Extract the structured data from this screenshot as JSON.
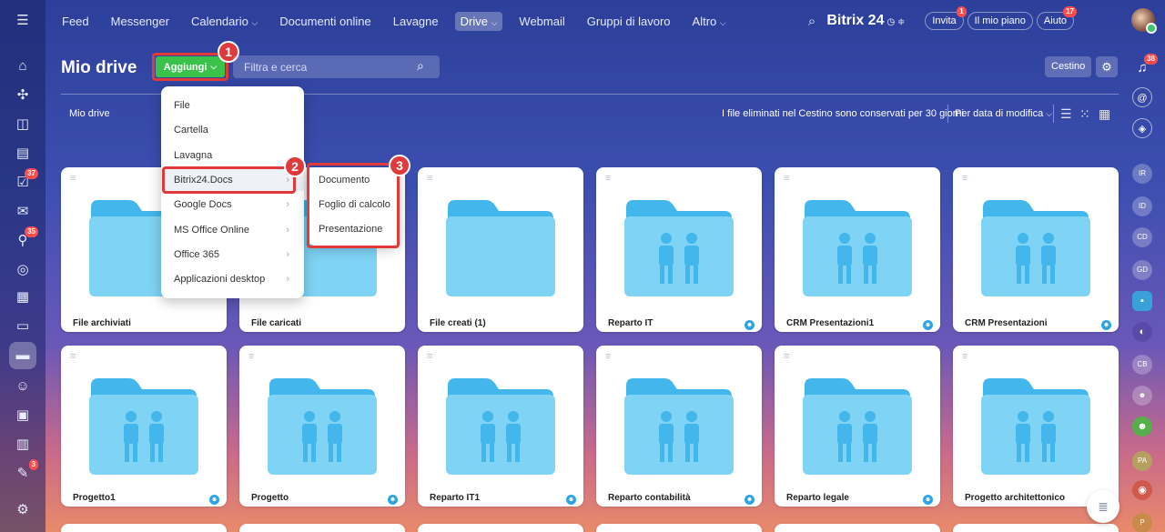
{
  "top_nav": {
    "items": [
      "Feed",
      "Messenger",
      "Calendario",
      "Documenti online",
      "Lavagne",
      "Drive",
      "Webmail",
      "Gruppi di lavoro",
      "Altro"
    ],
    "brand": "Bitrix 24",
    "invite": "Invita",
    "invite_badge": "1",
    "plan": "Il mio piano",
    "help": "Aiuto",
    "help_badge": "17"
  },
  "left_rail_badges": [
    "37",
    "35",
    "3"
  ],
  "right_rail": {
    "notifications_badge": "38",
    "avatars": [
      "IR",
      "ID",
      "CD",
      "GD",
      "CB",
      "PA",
      "P"
    ]
  },
  "page": {
    "title": "Mio drive",
    "add_label": "Aggiungi",
    "search_placeholder": "Filtra e cerca",
    "trash_label": "Cestino",
    "breadcrumb": "Mio drive",
    "trash_note": "I file eliminati nel Cestino sono conservati per 30 giorni",
    "sort_label": "Per data di modifica"
  },
  "menu_add": {
    "items": [
      {
        "label": "File",
        "arrow": false
      },
      {
        "label": "Cartella",
        "arrow": false
      },
      {
        "label": "Lavagna",
        "arrow": false
      },
      {
        "label": "Bitrix24.Docs",
        "arrow": true
      },
      {
        "label": "Google Docs",
        "arrow": true
      },
      {
        "label": "MS Office Online",
        "arrow": true
      },
      {
        "label": "Office 365",
        "arrow": true
      },
      {
        "label": "Applicazioni desktop",
        "arrow": true
      }
    ]
  },
  "menu_docs": {
    "items": [
      "Documento",
      "Foglio di calcolo",
      "Presentazione"
    ]
  },
  "callouts": [
    "1",
    "2",
    "3"
  ],
  "folders": [
    {
      "name": "File archiviati",
      "shared": false
    },
    {
      "name": "File caricati",
      "shared": false
    },
    {
      "name": "File creati (1)",
      "shared": false
    },
    {
      "name": "Reparto IT",
      "shared": true
    },
    {
      "name": "CRM Presentazioni1",
      "shared": true
    },
    {
      "name": "CRM Presentazioni",
      "shared": true
    },
    {
      "name": "Progetto1",
      "shared": true
    },
    {
      "name": "Progetto",
      "shared": true
    },
    {
      "name": "Reparto IT1",
      "shared": true
    },
    {
      "name": "Reparto contabilità",
      "shared": true
    },
    {
      "name": "Reparto legale",
      "shared": true
    },
    {
      "name": "Progetto architettonico",
      "shared": true
    }
  ],
  "colors": {
    "accent_green": "#3bc24b",
    "highlight_red": "#e03a3a",
    "folder_blue": "#7fd3f5",
    "folder_tab_blue": "#43b6ec",
    "share_blue": "#2fa4e0"
  }
}
